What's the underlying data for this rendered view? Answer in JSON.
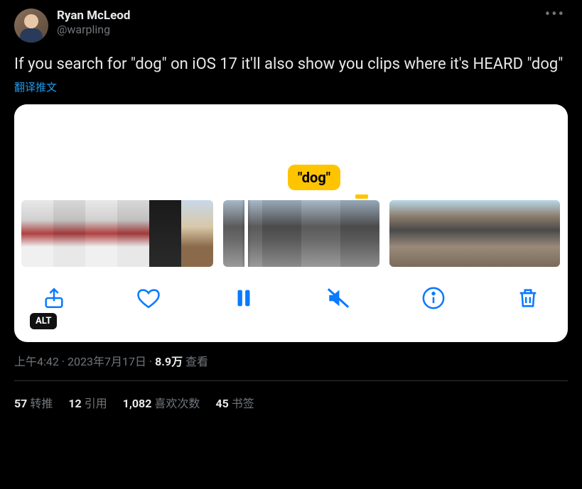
{
  "author": {
    "display_name": "Ryan McLeod",
    "handle": "@warpling"
  },
  "body": "If you search for \"dog\" on iOS 17 it'll also show you clips where it's HEARD \"dog\"",
  "translate_label": "翻译推文",
  "media": {
    "caption_label": "\"dog\"",
    "alt_badge": "ALT"
  },
  "meta": {
    "time": "上午4:42",
    "sep": " · ",
    "date": "2023年7月17日",
    "views_count": "8.9万",
    "views_label": " 查看"
  },
  "stats": {
    "retweets": {
      "count": "57",
      "label": "转推"
    },
    "quotes": {
      "count": "12",
      "label": "引用"
    },
    "likes": {
      "count": "1,082",
      "label": "喜欢次数"
    },
    "bookmarks": {
      "count": "45",
      "label": "书签"
    }
  }
}
